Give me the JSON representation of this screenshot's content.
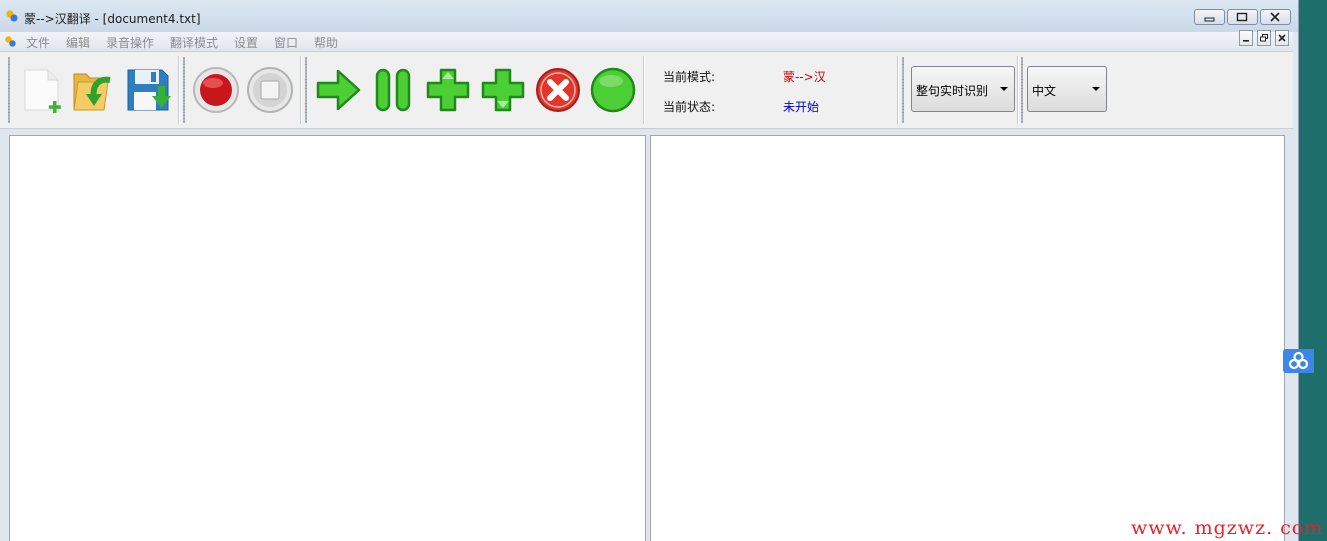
{
  "window": {
    "title": "蒙-->汉翻译 - [document4.txt]"
  },
  "menu": {
    "items": [
      {
        "label": "文件"
      },
      {
        "label": "编辑"
      },
      {
        "label": "录音操作"
      },
      {
        "label": "翻译模式"
      },
      {
        "label": "设置"
      },
      {
        "label": "窗口"
      },
      {
        "label": "帮助"
      }
    ]
  },
  "toolbar": {
    "buttons": [
      {
        "icon": "new-document-icon"
      },
      {
        "icon": "open-folder-icon"
      },
      {
        "icon": "save-floppy-icon"
      },
      {
        "icon": "record-icon"
      },
      {
        "icon": "stop-icon"
      },
      {
        "icon": "play-arrow-icon"
      },
      {
        "icon": "pause-icon"
      },
      {
        "icon": "plus-up-icon"
      },
      {
        "icon": "plus-down-icon"
      },
      {
        "icon": "cancel-icon"
      },
      {
        "icon": "green-circle-icon"
      }
    ],
    "status": {
      "mode_label": "当前模式:",
      "mode_value": "蒙-->汉",
      "state_label": "当前状态:",
      "state_value": "未开始"
    },
    "recognition_mode": {
      "selected": "整句实时识别"
    },
    "language": {
      "selected": "中文"
    }
  },
  "watermark": "www. mgzwz. com",
  "colors": {
    "mode_value": "#cc0000",
    "state_value": "#0000cc",
    "watermark": "#e8202a",
    "desktop_teal": "#1e6f6b"
  }
}
